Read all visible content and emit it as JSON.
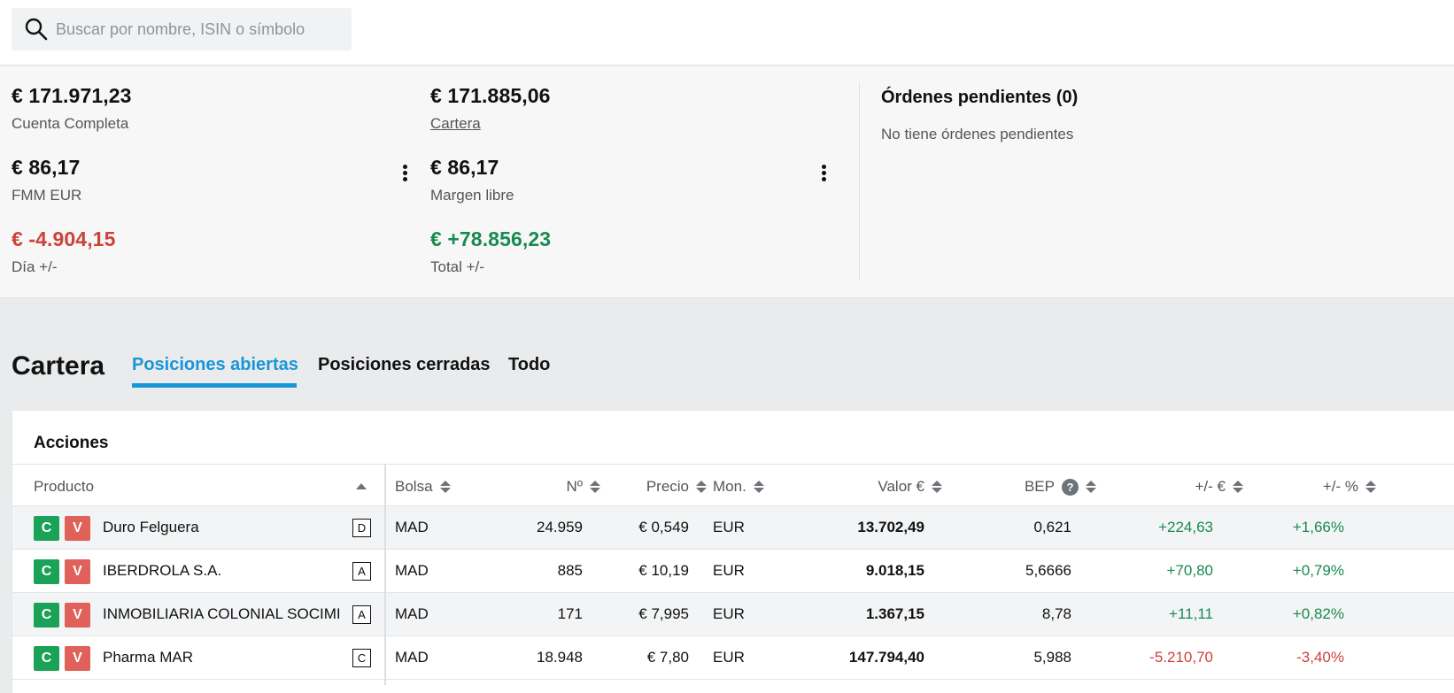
{
  "search": {
    "placeholder": "Buscar por nombre, ISIN o símbolo"
  },
  "summary": {
    "cuenta_completa": {
      "value": "€ 171.971,23",
      "label": "Cuenta Completa"
    },
    "cartera": {
      "value": "€ 171.885,06",
      "label": "Cartera"
    },
    "fmm": {
      "value": "€ 86,17",
      "label": "FMM EUR"
    },
    "margen": {
      "value": "€ 86,17",
      "label": "Margen libre"
    },
    "dia": {
      "value": "€ -4.904,15",
      "label": "Día +/-"
    },
    "total": {
      "value": "€ +78.856,23",
      "label": "Total +/-"
    }
  },
  "orders": {
    "title": "Órdenes pendientes (0)",
    "empty": "No tiene órdenes pendientes"
  },
  "portfolio": {
    "title": "Cartera",
    "tabs": [
      {
        "label": "Posiciones abiertas",
        "active": true
      },
      {
        "label": "Posiciones cerradas",
        "active": false
      },
      {
        "label": "Todo",
        "active": false
      }
    ]
  },
  "table": {
    "section_title": "Acciones",
    "headers": {
      "producto": "Producto",
      "bolsa": "Bolsa",
      "n": "Nº",
      "precio": "Precio",
      "mon": "Mon.",
      "valor": "Valor €",
      "bep": "BEP",
      "pl_eur": "+/- €",
      "pl_pct": "+/- %"
    },
    "buy_label": "C",
    "sell_label": "V",
    "rows": [
      {
        "product": "Duro Felguera",
        "badge": "D",
        "bolsa": "MAD",
        "n": "24.959",
        "precio": "€ 0,549",
        "mon": "EUR",
        "valor": "13.702,49",
        "bep": "0,621",
        "pl_eur": "+224,63",
        "pl_pct": "+1,66%"
      },
      {
        "product": "IBERDROLA S.A.",
        "badge": "A",
        "bolsa": "MAD",
        "n": "885",
        "precio": "€ 10,19",
        "mon": "EUR",
        "valor": "9.018,15",
        "bep": "5,6666",
        "pl_eur": "+70,80",
        "pl_pct": "+0,79%"
      },
      {
        "product": "INMOBILIARIA COLONIAL SOCIMI",
        "badge": "A",
        "bolsa": "MAD",
        "n": "171",
        "precio": "€ 7,995",
        "mon": "EUR",
        "valor": "1.367,15",
        "bep": "8,78",
        "pl_eur": "+11,11",
        "pl_pct": "+0,82%"
      },
      {
        "product": "Pharma MAR",
        "badge": "C",
        "bolsa": "MAD",
        "n": "18.948",
        "precio": "€ 7,80",
        "mon": "EUR",
        "valor": "147.794,40",
        "bep": "5,988",
        "pl_eur": "-5.210,70",
        "pl_pct": "-3,40%"
      }
    ]
  },
  "colors": {
    "accent": "#1996d8",
    "positive": "#188a51",
    "negative": "#c9443a",
    "buy": "#1aa257",
    "sell": "#e0605a"
  }
}
